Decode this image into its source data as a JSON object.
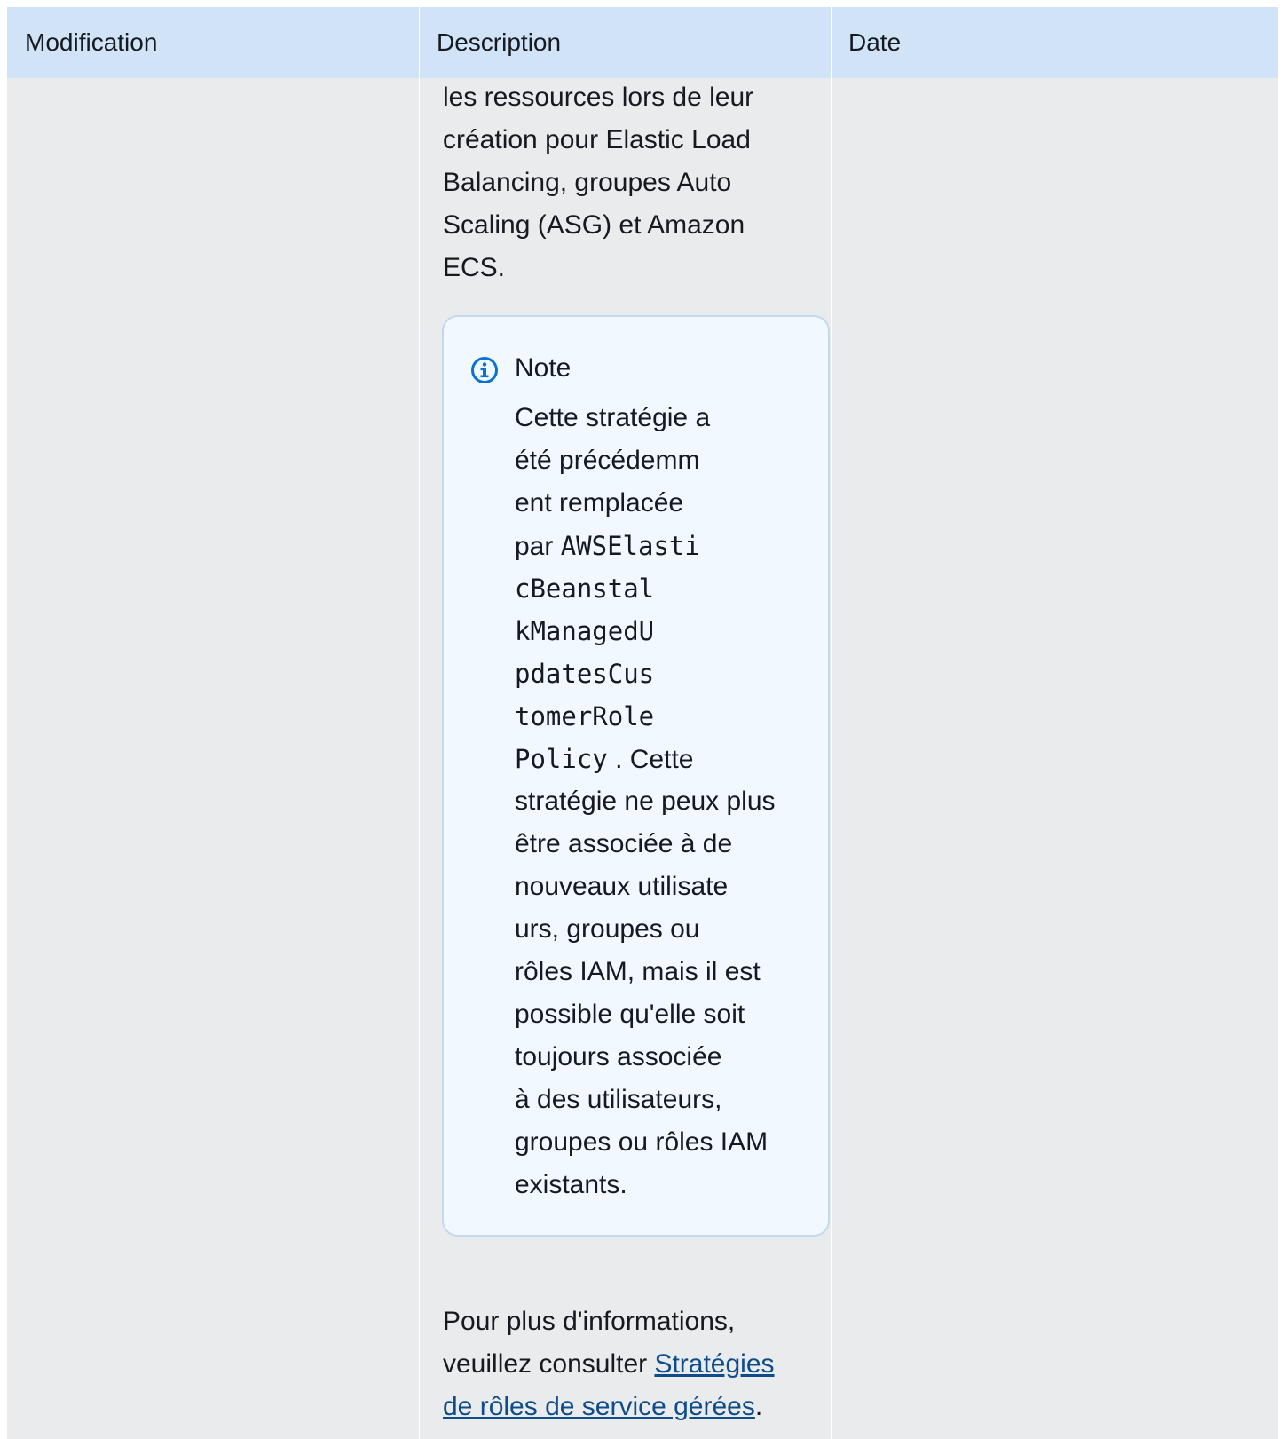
{
  "table": {
    "headers": [
      "Modification",
      "Description",
      "Date"
    ],
    "description_intro_lines": [
      "les ressources lors de leur",
      "création pour Elastic Load",
      "Balancing, groupes Auto",
      "Scaling (ASG) et Amazon",
      "ECS."
    ],
    "note": {
      "title": "Note",
      "icon": "info-icon",
      "l1": "Cette stratégie a",
      "l2": "été précédemm",
      "l3": "ent remplacée",
      "l4_prefix": "par ",
      "code_lines": [
        "AWSElasti",
        "cBeanstal",
        "kManagedU",
        "pdatesCus",
        "tomerRole",
        "Policy"
      ],
      "after_code": " . Cette",
      "rest_lines": [
        "stratégie ne peux plus",
        "être associée à de",
        "nouveaux utilisate",
        "urs, groupes ou",
        "rôles IAM, mais il est",
        "possible qu'elle soit",
        "toujours associée",
        "à des utilisateurs,",
        "groupes ou rôles IAM",
        "existants."
      ]
    },
    "more_info": {
      "line1": "Pour plus d'informations,",
      "line2_prefix": "veuillez consulter ",
      "link_part1": "Stratégies",
      "link_part2": "de rôles de service gérées",
      "suffix": "."
    }
  },
  "colors": {
    "header_bg": "#d1e4f7",
    "body_bg": "#e9ebed",
    "note_bg": "#f1f8ff",
    "note_border": "#c2d9ef",
    "info_icon": "#0972d3",
    "link": "#0f4c8a"
  }
}
